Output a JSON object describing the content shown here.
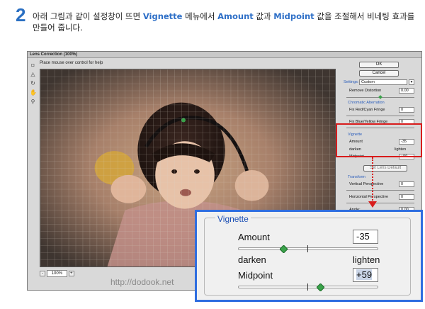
{
  "instruction": {
    "step_number": "2",
    "text_before": "아래 그림과 같이 설정창이 뜨면 ",
    "kw1": "Vignette",
    "text_mid1": " 메뉴에서 ",
    "kw2": "Amount",
    "text_mid2": " 값과 ",
    "kw3": "Midpoint",
    "text_after": " 값을 조절해서 비네팅 효과를 만들어 줍니다."
  },
  "dialog": {
    "title": "Lens Correction (100%)",
    "hint": "Place mouse over control for help",
    "zoom_minus": "-",
    "zoom_value": "100%",
    "zoom_plus": "+",
    "watermark": "http://dodook.net"
  },
  "panel": {
    "ok_label": "OK",
    "cancel_label": "Cancel",
    "settings_label": "Settings:",
    "settings_value": "Custom",
    "remove_distortion_label": "Remove Distortion",
    "remove_distortion_value": "0.00",
    "chromatic_label": "Chromatic Aberration",
    "fix_red_cyan_label": "Fix Red/Cyan Fringe",
    "fix_red_cyan_value": "0",
    "fix_blue_yellow_label": "Fix Blue/Yellow Fringe",
    "fix_blue_yellow_value": "0",
    "vignette_label": "Vignette",
    "amount_label": "Amount",
    "amount_value": "-35",
    "darken_label": "darken",
    "lighten_label": "lighten",
    "midpoint_label": "Midpoint",
    "midpoint_value": "+59",
    "set_default_label": "Set Lens Default",
    "transform_label": "Transform",
    "vertical_perspective_label": "Vertical Perspective",
    "vertical_perspective_value": "0",
    "horizontal_perspective_label": "Horizontal Perspective",
    "horizontal_perspective_value": "0",
    "angle_label": "Angle:",
    "angle_value": "0.00"
  },
  "zoom_inset": {
    "group_title": "Vignette",
    "amount_label": "Amount",
    "amount_value": "-35",
    "amount_level_percent": 32.5,
    "darken_label": "darken",
    "lighten_label": "lighten",
    "midpoint_label": "Midpoint",
    "midpoint_value": "+59",
    "midpoint_level_percent": 59
  },
  "colors": {
    "accent_blue": "#2f6ee0",
    "highlight_red": "#d81c1c",
    "slider_thumb": "#3aa24a"
  }
}
